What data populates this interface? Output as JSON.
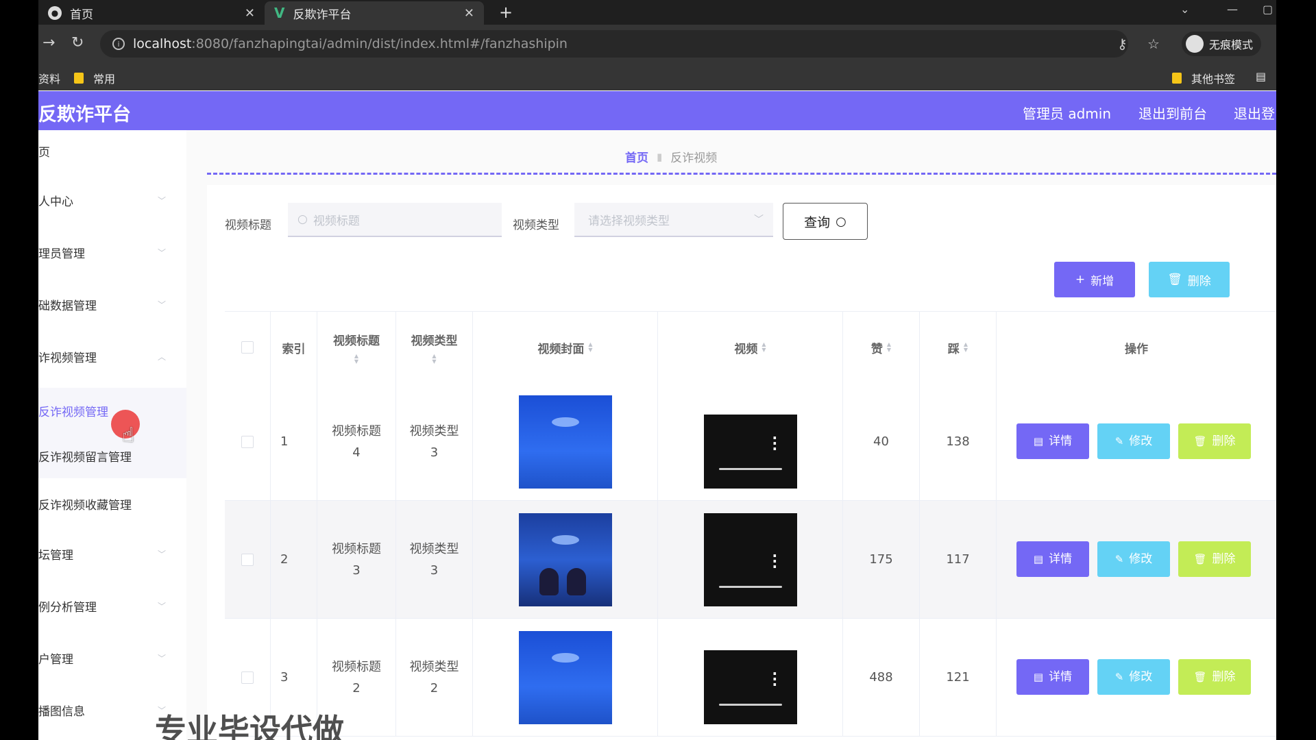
{
  "browser": {
    "tabs": [
      {
        "title": "首页",
        "active": false
      },
      {
        "title": "反欺诈平台",
        "active": true
      }
    ],
    "url_host": "localhost",
    "url_rest": ":8080/fanzhapingtai/admin/dist/index.html#/fanzhashipin",
    "incognito_label": "无痕模式",
    "bookmarks": [
      {
        "label": "资料"
      },
      {
        "label": "常用"
      }
    ],
    "other_bookmarks": "其他书签"
  },
  "header": {
    "brand": "反欺诈平台",
    "admin_label": "管理员 admin",
    "to_front": "退出到前台",
    "logout": "退出登"
  },
  "sidebar": {
    "items": [
      {
        "label": "页"
      },
      {
        "label": "人中心"
      },
      {
        "label": "理员管理"
      },
      {
        "label": "础数据管理"
      },
      {
        "label": "诈视频管理"
      },
      {
        "label": "反诈视频管理"
      },
      {
        "label": "反诈视频留言管理"
      },
      {
        "label": "反诈视频收藏管理"
      },
      {
        "label": "坛管理"
      },
      {
        "label": "例分析管理"
      },
      {
        "label": "户管理"
      },
      {
        "label": "播图信息"
      }
    ]
  },
  "breadcrumb": {
    "home": "首页",
    "current": "反诈视频"
  },
  "search": {
    "title_label": "视频标题",
    "title_placeholder": "视频标题",
    "type_label": "视频类型",
    "type_placeholder": "请选择视频类型",
    "query_button": "查询"
  },
  "actions": {
    "add": "新增",
    "delete": "删除"
  },
  "table": {
    "columns": [
      "索引",
      "视频标题",
      "视频类型",
      "视频封面",
      "视频",
      "赞",
      "踩",
      "操作"
    ],
    "rows": [
      {
        "index": "1",
        "title": "视频标题4",
        "type": "视频类型3",
        "likes": "40",
        "dislikes": "138"
      },
      {
        "index": "2",
        "title": "视频标题3",
        "type": "视频类型3",
        "likes": "175",
        "dislikes": "117"
      },
      {
        "index": "3",
        "title": "视频标题2",
        "type": "视频类型2",
        "likes": "488",
        "dislikes": "121"
      }
    ],
    "row_actions": {
      "detail": "详情",
      "edit": "修改",
      "delete": "删除"
    }
  },
  "watermark": "专业毕设代做",
  "colors": {
    "primary": "#7468f5",
    "info": "#64d2f5",
    "warning": "#c3ec56"
  }
}
